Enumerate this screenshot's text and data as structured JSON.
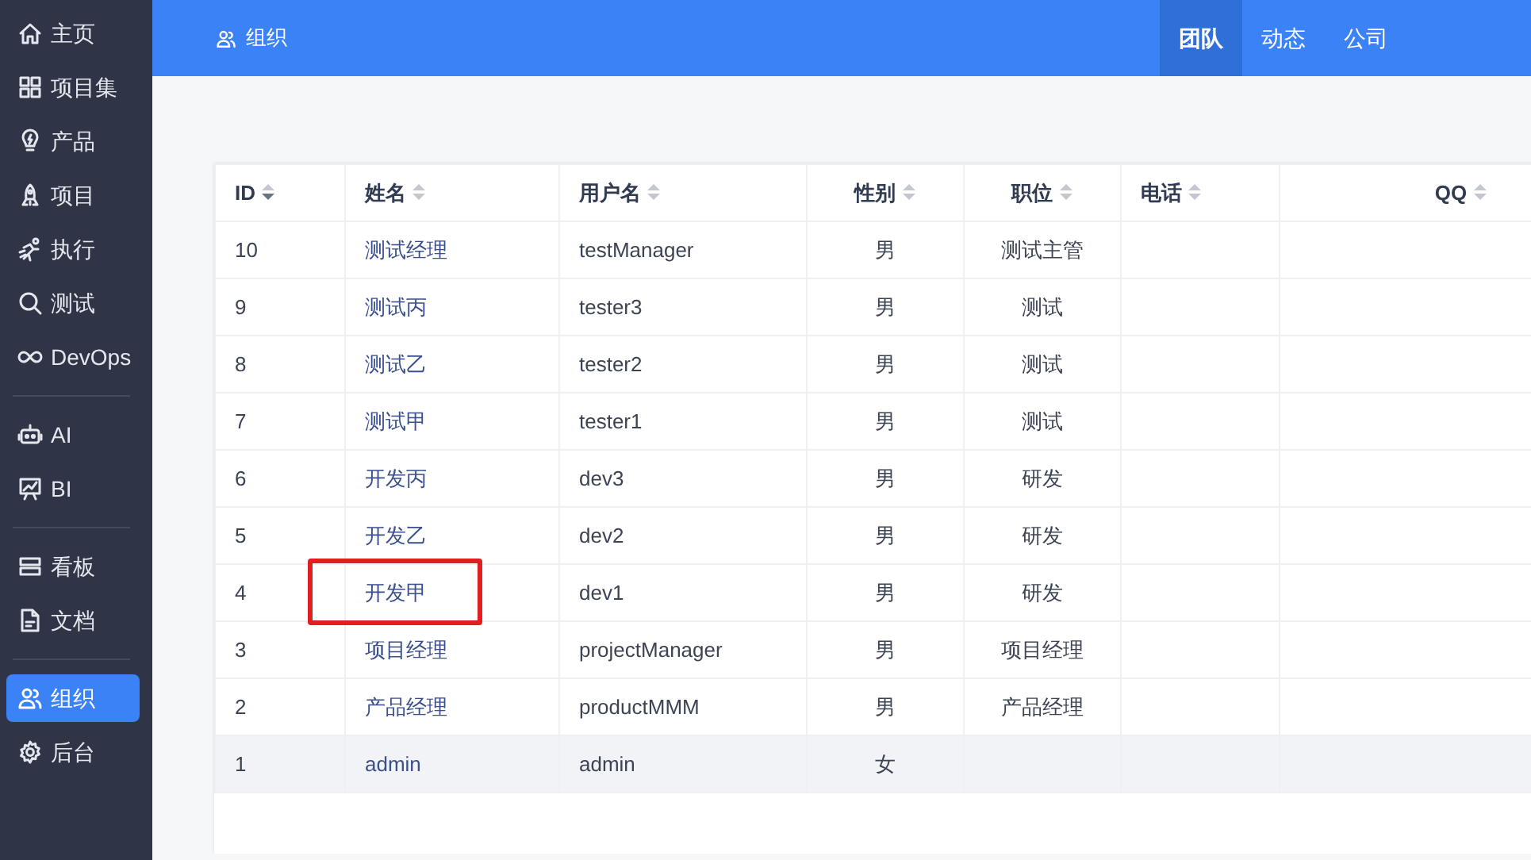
{
  "sidebar": {
    "groups": [
      {
        "items": [
          {
            "label": "主页",
            "selected": false
          },
          {
            "label": "项目集",
            "selected": false
          },
          {
            "label": "产品",
            "selected": false
          },
          {
            "label": "项目",
            "selected": false
          },
          {
            "label": "执行",
            "selected": false
          },
          {
            "label": "测试",
            "selected": false
          },
          {
            "label": "DevOps",
            "selected": false
          }
        ]
      },
      {
        "items": [
          {
            "label": "AI",
            "selected": false
          },
          {
            "label": "BI",
            "selected": false
          }
        ]
      },
      {
        "items": [
          {
            "label": "看板",
            "selected": false
          },
          {
            "label": "文档",
            "selected": false
          }
        ]
      },
      {
        "items": [
          {
            "label": "组织",
            "selected": true
          },
          {
            "label": "后台",
            "selected": false
          }
        ]
      }
    ]
  },
  "header": {
    "title": "组织",
    "tabs": [
      {
        "label": "团队",
        "selected": true
      },
      {
        "label": "动态",
        "selected": false
      },
      {
        "label": "公司",
        "selected": false
      }
    ]
  },
  "table": {
    "columns": [
      {
        "label": "ID",
        "sorted": true
      },
      {
        "label": "姓名",
        "sorted": false
      },
      {
        "label": "用户名",
        "sorted": false
      },
      {
        "label": "性别",
        "sorted": false
      },
      {
        "label": "职位",
        "sorted": false
      },
      {
        "label": "电话",
        "sorted": false
      },
      {
        "label": "QQ",
        "sorted": false
      }
    ],
    "rows": [
      {
        "id": "10",
        "name": "测试经理",
        "username": "testManager",
        "gender": "男",
        "position": "测试主管",
        "hovered": false,
        "annotated": false
      },
      {
        "id": "9",
        "name": "测试丙",
        "username": "tester3",
        "gender": "男",
        "position": "测试",
        "hovered": false,
        "annotated": false
      },
      {
        "id": "8",
        "name": "测试乙",
        "username": "tester2",
        "gender": "男",
        "position": "测试",
        "hovered": false,
        "annotated": false
      },
      {
        "id": "7",
        "name": "测试甲",
        "username": "tester1",
        "gender": "男",
        "position": "测试",
        "hovered": false,
        "annotated": false
      },
      {
        "id": "6",
        "name": "开发丙",
        "username": "dev3",
        "gender": "男",
        "position": "研发",
        "hovered": false,
        "annotated": false
      },
      {
        "id": "5",
        "name": "开发乙",
        "username": "dev2",
        "gender": "男",
        "position": "研发",
        "hovered": false,
        "annotated": false
      },
      {
        "id": "4",
        "name": "开发甲",
        "username": "dev1",
        "gender": "男",
        "position": "研发",
        "hovered": false,
        "annotated": true
      },
      {
        "id": "3",
        "name": "项目经理",
        "username": "projectManager",
        "gender": "男",
        "position": "项目经理",
        "hovered": false,
        "annotated": false
      },
      {
        "id": "2",
        "name": "产品经理",
        "username": "productMMM",
        "gender": "男",
        "position": "产品经理",
        "hovered": false,
        "annotated": false
      },
      {
        "id": "1",
        "name": "admin",
        "username": "admin",
        "gender": "女",
        "hovered": true,
        "annotated": false
      }
    ]
  }
}
